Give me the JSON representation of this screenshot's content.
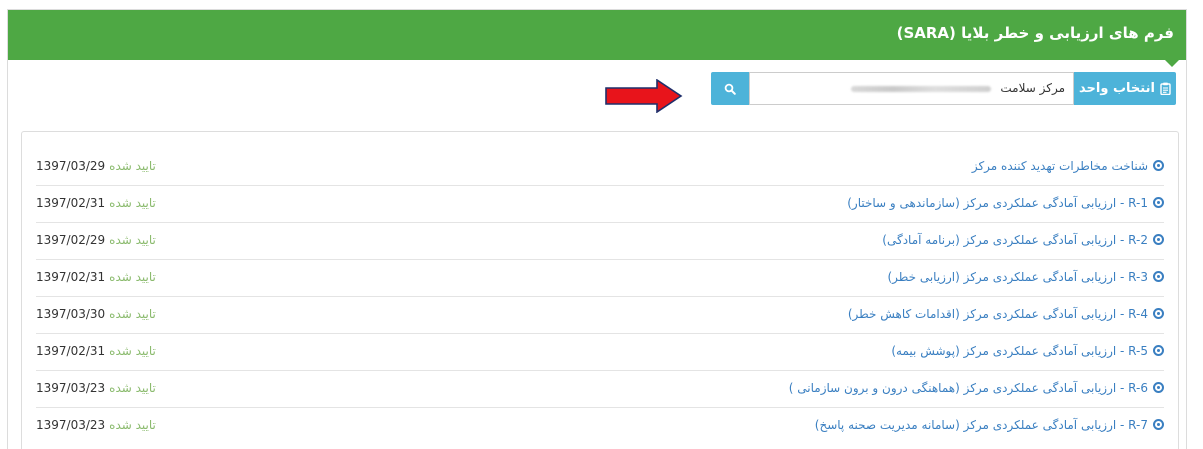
{
  "panel": {
    "title": "فرم های ارزیابی و خطر بلایا (SARA)"
  },
  "search": {
    "select_unit_label": "انتخاب واحد",
    "input_value": "مرکز سلامت"
  },
  "status_text": "تایید شده",
  "rows": [
    {
      "title": "شناخت مخاطرات تهدید کننده مرکز",
      "date": "1397/03/29"
    },
    {
      "title": "R-1 - ارزیابی آمادگی عملکردی مرکز (سازماندهی و ساختار)",
      "date": "1397/02/31"
    },
    {
      "title": "R-2 - ارزیابی آمادگی عملکردی مرکز (برنامه آمادگی)",
      "date": "1397/02/29"
    },
    {
      "title": "R-3 - ارزیابی آمادگی عملکردی مرکز (ارزیابی خطر)",
      "date": "1397/02/31"
    },
    {
      "title": "R-4 - ارزیابی آمادگی عملکردی مرکز (اقدامات کاهش خطر)",
      "date": "1397/03/30"
    },
    {
      "title": "R-5 - ارزیابی آمادگی عملکردی مرکز (پوشش بیمه)",
      "date": "1397/02/31"
    },
    {
      "title": "R-6 - ارزیابی آمادگی عملکردی مرکز (هماهنگی درون و برون سازمانی )",
      "date": "1397/03/23"
    },
    {
      "title": "R-7 - ارزیابی آمادگی عملکردی مرکز (سامانه مدیریت صحنه پاسخ)",
      "date": "1397/03/23"
    }
  ],
  "colors": {
    "header_green": "#4ea844",
    "accent_blue": "#4db3d9",
    "link_blue": "#3a7fc1",
    "status_green": "#8bbb6e",
    "arrow_red": "#e8141b"
  },
  "icons": {
    "select_unit": "clipboard-icon",
    "search": "search-icon",
    "row_bullet": "circle-dot-icon",
    "pointer": "red-arrow-icon"
  }
}
